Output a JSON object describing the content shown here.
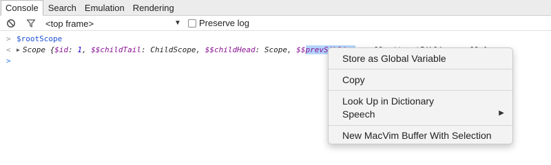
{
  "tabs": [
    {
      "label": "Console",
      "active": true
    },
    {
      "label": "Search",
      "active": false
    },
    {
      "label": "Emulation",
      "active": false
    },
    {
      "label": "Rendering",
      "active": false
    }
  ],
  "toolbar": {
    "clear_icon": "clear-console-icon",
    "filter_icon": "filter-icon",
    "frame_select_value": "<top frame>",
    "preserve_log_label": "Preserve log",
    "preserve_log_checked": false
  },
  "console": {
    "command": "$rootScope",
    "result": {
      "prefix": "Scope {",
      "k1": "$id",
      "v1": "1",
      "k2": "$$childTail",
      "v2": "ChildScope",
      "k3": "$$childHead",
      "v3": "Scope",
      "k4_pre": "$$",
      "k4_sel": "prevSibling",
      "rest": ": null, $$nextSibling: null…}"
    }
  },
  "context_menu": {
    "items": [
      "Store as Global Variable",
      "Copy",
      "Look Up in Dictionary",
      "Speech",
      "New MacVim Buffer With Selection"
    ]
  },
  "colors": {
    "prompt": "#367cf1",
    "property": "#881391",
    "number": "#1c00cf",
    "selection": "#b3d4fd"
  }
}
